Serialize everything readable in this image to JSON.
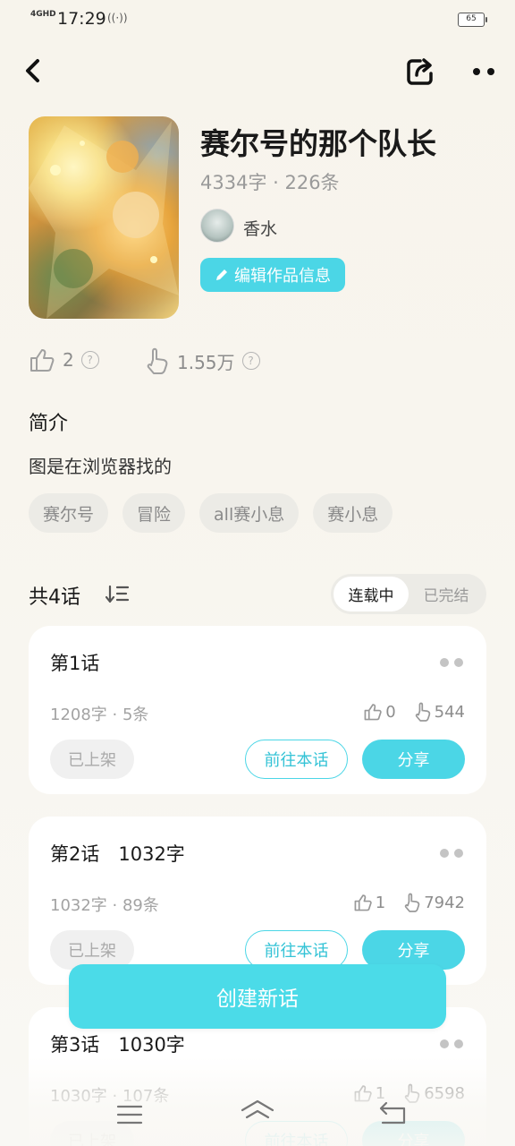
{
  "status_bar": {
    "network": "4GHD",
    "time": "17:29",
    "battery": "65"
  },
  "work": {
    "title": "赛尔号的那个队长",
    "stats": "4334字 · 226条",
    "author": "香水",
    "edit_label": "编辑作品信息",
    "likes": "2",
    "upvotes": "1.55万"
  },
  "intro": {
    "heading": "简介",
    "text": "图是在浏览器找的"
  },
  "tags": [
    "赛尔号",
    "冒险",
    "all赛小息",
    "赛小息"
  ],
  "chapters_header": {
    "count": "共4话",
    "status_tabs": [
      "连载中",
      "已完结"
    ],
    "active_tab": "连载中"
  },
  "chapters": [
    {
      "title": "第1话",
      "stats": "1208字 · 5条",
      "likes": "0",
      "upvotes": "544",
      "shelf": "已上架",
      "goto": "前往本话",
      "share": "分享"
    },
    {
      "title": "第2话　1032字",
      "stats": "1032字 · 89条",
      "likes": "1",
      "upvotes": "7942",
      "shelf": "已上架",
      "goto": "前往本话",
      "share": "分享"
    },
    {
      "title": "第3话　1030字",
      "stats": "1030字 · 107条",
      "likes": "1",
      "upvotes": "6598",
      "shelf": "已上架",
      "goto": "前往本话",
      "share": "分享"
    }
  ],
  "create_label": "创建新话",
  "colors": {
    "accent": "#4bd6e6",
    "background": "#f8f5ee"
  }
}
